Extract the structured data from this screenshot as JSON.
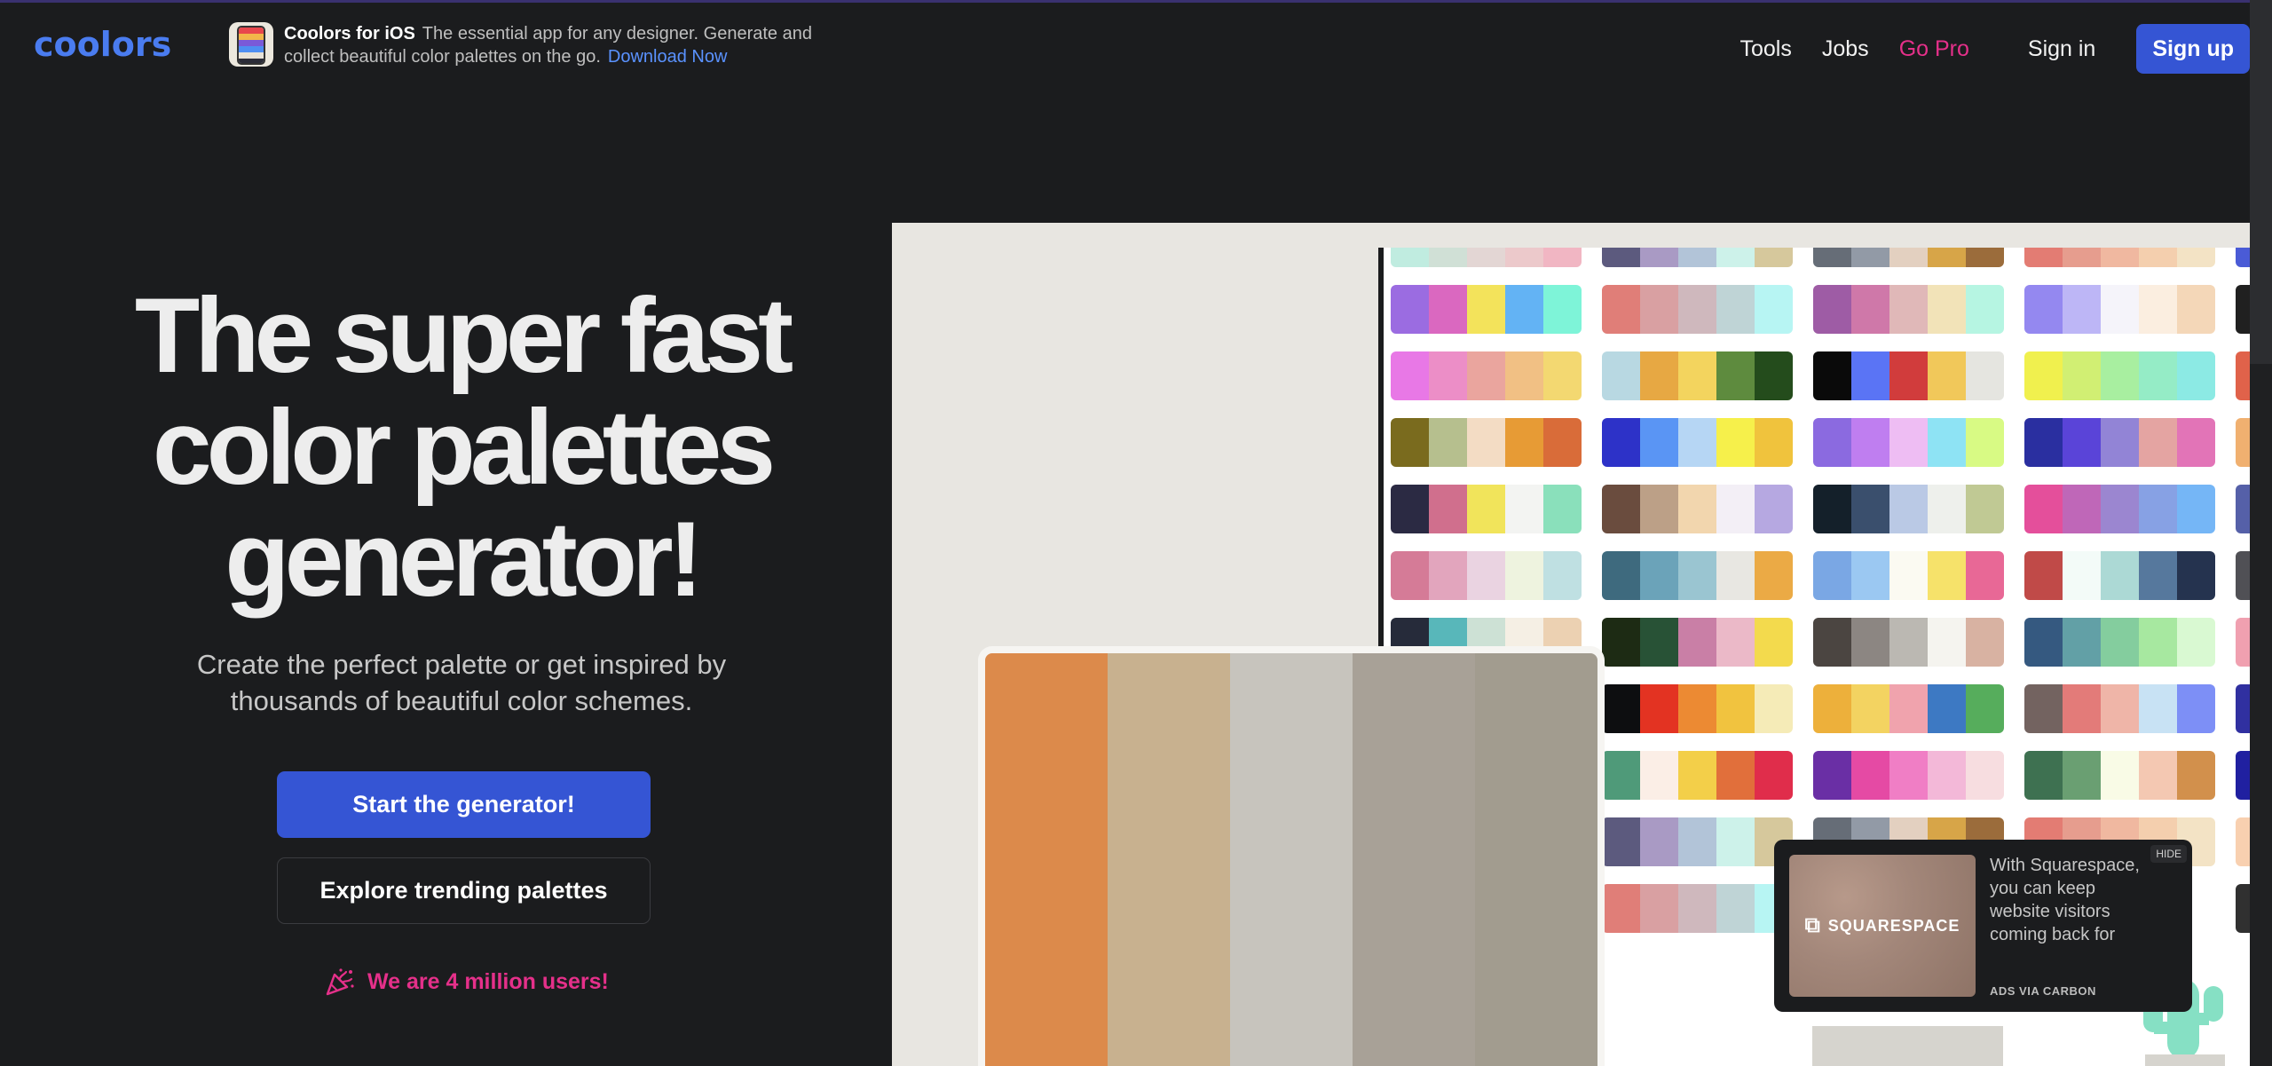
{
  "header": {
    "logo": "coolors",
    "promo_title": "Coolors for iOS",
    "promo_text": "The essential app for any designer. Generate and collect beautiful color palettes on the go.",
    "promo_link": "Download Now",
    "nav": {
      "tools": "Tools",
      "jobs": "Jobs",
      "go_pro": "Go Pro",
      "sign_in": "Sign in",
      "sign_up": "Sign up"
    }
  },
  "hero": {
    "title_line1": "The super fast",
    "title_line2": "color palettes",
    "title_line3": "generator!",
    "subtitle": "Create the perfect palette or get inspired by thousands of beautiful color schemes.",
    "start_button": "Start the generator!",
    "explore_button": "Explore trending palettes",
    "users_text": "We are 4 million users!",
    "users_icon": "party-popper-icon"
  },
  "illustration": {
    "featured_palette": [
      "#dc8a4b",
      "#c8b18f",
      "#c7c4bd",
      "#a8a197",
      "#a29c8f"
    ],
    "palette_columns": [
      [
        [
          "#c0ece0",
          "#d0e0d6",
          "#e3d6d4",
          "#ecc9cb",
          "#f1b6c3"
        ],
        [
          "#9b6ce1",
          "#da68c0",
          "#f3e35b",
          "#63b3f4",
          "#7ef4d8"
        ],
        [
          "#e878e6",
          "#ec8ec7",
          "#eaa59e",
          "#f1c084",
          "#f3d871"
        ],
        [
          "#7a6b1e",
          "#b6bf8e",
          "#f3dcc4",
          "#e79b35",
          "#d96c39"
        ],
        [
          "#2b2a43",
          "#d06f8d",
          "#f1e45b",
          "#f3f4f2",
          "#8ae0bb"
        ],
        [
          "#d57b97",
          "#e2a5bd",
          "#ead3e1",
          "#eef3df",
          "#bfe0e2"
        ],
        [
          "#262b3a",
          "#58b7ba",
          "#cde1d5",
          "#f5efe4",
          "#ecd1b2"
        ]
      ],
      [
        [
          "#5c5a7e",
          "#a99ac4",
          "#b2c4d8",
          "#cdf2ea",
          "#d6c89c"
        ],
        [
          "#e07e78",
          "#d9a0a2",
          "#cfb8bd",
          "#bfd4d6",
          "#b7f5f3"
        ],
        [
          "#b8d8e2",
          "#e7a843",
          "#f3d45e",
          "#5e8b3e",
          "#244c1c"
        ],
        [
          "#2d32c8",
          "#5a95f4",
          "#b6d6f4",
          "#f6f04b",
          "#f0c33d"
        ],
        [
          "#6a4c3e",
          "#bca087",
          "#f2d6ae",
          "#f3eff6",
          "#b6a8e1"
        ],
        [
          "#3e6a7e",
          "#6ba3b9",
          "#9ac5d1",
          "#e8e7e2",
          "#ebaa45"
        ],
        [
          "#1d2b14",
          "#285236",
          "#c97fa6",
          "#ebb9c8",
          "#f3da4d"
        ],
        [
          "#0d0e10",
          "#e33322",
          "#ec8a33",
          "#f1c33f",
          "#f5ebb7"
        ],
        [
          "#4f9a79",
          "#fbeee6",
          "#f3cf49",
          "#e16f3b",
          "#e02d4b"
        ],
        [
          "#5c5a7e",
          "#a99ac4",
          "#b2c4d8",
          "#cdf2ea",
          "#d6c89c"
        ],
        [
          "#e07e78",
          "#d9a0a2",
          "#cfb8bd",
          "#bfd4d6",
          "#b7f5f3"
        ]
      ],
      [
        [
          "#666d77",
          "#929aa6",
          "#e3d0c0",
          "#d7a548",
          "#9b6c3b"
        ],
        [
          "#9e5ca5",
          "#cf78a9",
          "#e0b8b8",
          "#f2e3b8",
          "#b6f5e2"
        ],
        [
          "#0a0a0a",
          "#5a74f5",
          "#d13c3c",
          "#f1c85a",
          "#e5e5e0"
        ],
        [
          "#8b6ae0",
          "#bf7ef0",
          "#eebdf3",
          "#8ee3f4",
          "#d8fa84"
        ],
        [
          "#14202a",
          "#3a4f6d",
          "#bac9e5",
          "#eef0ec",
          "#c0c994"
        ],
        [
          "#7aa7e4",
          "#9bc8f2",
          "#fbfaf2",
          "#f6e26a",
          "#e86896"
        ],
        [
          "#4b4541",
          "#8c8682",
          "#bbb8b2",
          "#f5f4ef",
          "#d8b2a2"
        ],
        [
          "#edb03b",
          "#f3d361",
          "#f0a3ad",
          "#3d79c3",
          "#56ad5c"
        ],
        [
          "#6a2fa5",
          "#e54aa4",
          "#f07ec5",
          "#f3b8d8",
          "#f7dde0"
        ],
        [
          "#666d77",
          "#929aa6",
          "#e3d0c0",
          "#d7a548",
          "#9b6c3b"
        ]
      ],
      [
        [
          "#e37c73",
          "#e69d8e",
          "#f0b8a0",
          "#f4cfae",
          "#f3e3c5"
        ],
        [
          "#9488f0",
          "#bdb6f6",
          "#f5f4fa",
          "#fbeee0",
          "#f4d7b8"
        ],
        [
          "#f0f04e",
          "#d1ef73",
          "#a8efa0",
          "#95ecc6",
          "#8ceae4"
        ],
        [
          "#2a2fa0",
          "#5a44d8",
          "#9284d6",
          "#e4a4a2",
          "#e274b7"
        ],
        [
          "#e44f9b",
          "#bf67b8",
          "#9b86d0",
          "#87a1e4",
          "#75b6f6"
        ],
        [
          "#c04a48",
          "#f3fbf8",
          "#acd9d5",
          "#56789d",
          "#25334f"
        ],
        [
          "#355980",
          "#62a0a6",
          "#84cd9e",
          "#a7e8a0",
          "#d9f9d2"
        ],
        [
          "#736360",
          "#e37b79",
          "#efb5a8",
          "#c8e2f4",
          "#7d8ff6"
        ],
        [
          "#3e7151",
          "#6a9f72",
          "#f9fbe6",
          "#f4c8b2",
          "#d2904c"
        ],
        [
          "#e37c73",
          "#e69d8e",
          "#f0b8a0",
          "#f4cfae",
          "#f3e3c5"
        ]
      ]
    ]
  },
  "ad": {
    "brand": "SQUARESPACE",
    "text": "With Squarespace, you can keep website visitors coming back for",
    "via": "ADS VIA CARBON",
    "hide": "HIDE"
  },
  "colors": {
    "background": "#1b1c1e",
    "accent_blue": "#3555d4",
    "pink": "#e5308a",
    "logo_blue": "#4a7cf0"
  }
}
